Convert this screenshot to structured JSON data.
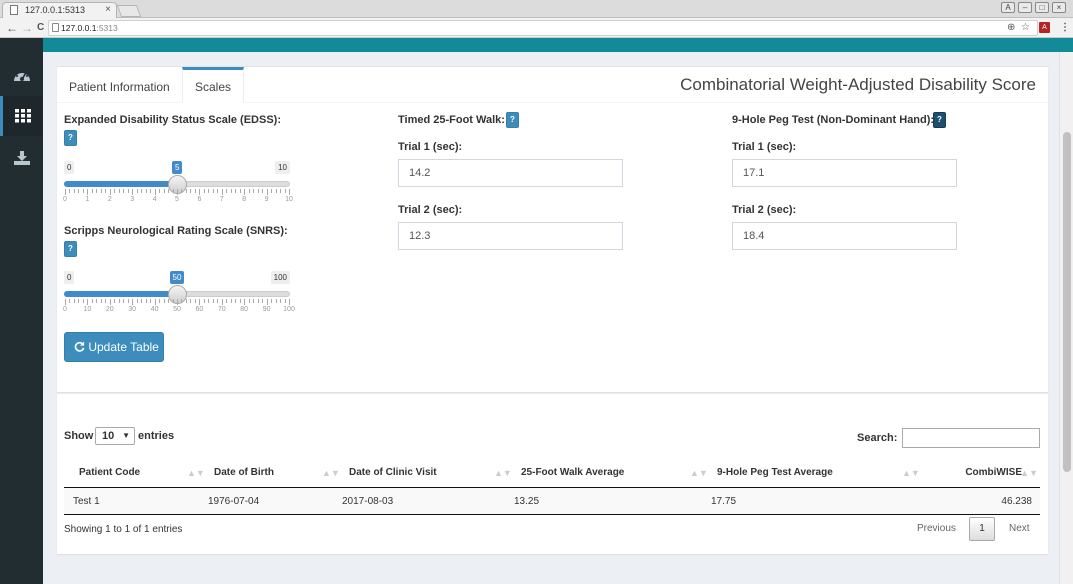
{
  "browser": {
    "tab_title": "127.0.0.1:5313",
    "tab_close": "×",
    "url_host": "127.0.0.1",
    "url_port": ":5313",
    "back": "←",
    "forward": "→",
    "reload": "C",
    "zoom": "⊕",
    "star": "☆",
    "ext": "A",
    "menu": "⋮",
    "win_user": "A",
    "win_min": "–",
    "win_max": "□",
    "win_close": "×"
  },
  "sidebar": {
    "items": [
      {
        "icon": "dashboard-icon"
      },
      {
        "icon": "grid-icon",
        "active": true
      },
      {
        "icon": "download-icon"
      }
    ]
  },
  "tabs": [
    "Patient Information",
    "Scales"
  ],
  "box_title": "Combinatorial Weight-Adjusted Disability Score",
  "help": "?",
  "edss": {
    "label": "Expanded Disability Status Scale (EDSS):",
    "min": "0",
    "max": "10",
    "value": 5,
    "value_label": "5",
    "ticks": [
      "0",
      "1",
      "2",
      "3",
      "4",
      "5",
      "6",
      "7",
      "8",
      "9",
      "10"
    ]
  },
  "snrs": {
    "label": "Scripps Neurological Rating Scale (SNRS):",
    "min": "0",
    "max": "100",
    "value": 50,
    "value_label": "50",
    "ticks": [
      "0",
      "10",
      "20",
      "30",
      "40",
      "50",
      "60",
      "70",
      "80",
      "90",
      "100"
    ]
  },
  "update_button": "Update Table",
  "walk": {
    "label": "Timed 25-Foot Walk:",
    "trial1_label": "Trial 1 (sec):",
    "trial1_value": "14.2",
    "trial2_label": "Trial 2 (sec):",
    "trial2_value": "12.3"
  },
  "peg": {
    "label": "9-Hole Peg Test (Non-Dominant Hand):",
    "trial1_label": "Trial 1 (sec):",
    "trial1_value": "17.1",
    "trial2_label": "Trial 2 (sec):",
    "trial2_value": "18.4"
  },
  "table": {
    "show_label": "Show",
    "entries_label": "entries",
    "length_value": "10",
    "search_label": "Search:",
    "columns": [
      "Patient Code",
      "Date of Birth",
      "Date of Clinic Visit",
      "25-Foot Walk Average",
      "9-Hole Peg Test Average",
      "CombiWISE"
    ],
    "rows": [
      [
        "Test 1",
        "1976-07-04",
        "2017-08-03",
        "13.25",
        "17.75",
        "46.238"
      ]
    ],
    "info": "Showing 1 to 1 of 1 entries",
    "prev": "Previous",
    "page": "1",
    "next": "Next"
  },
  "colors": {
    "topbar": "#128a98",
    "sidebar": "#222d32",
    "primary": "#3c8dbc",
    "slider": "#428bca"
  }
}
